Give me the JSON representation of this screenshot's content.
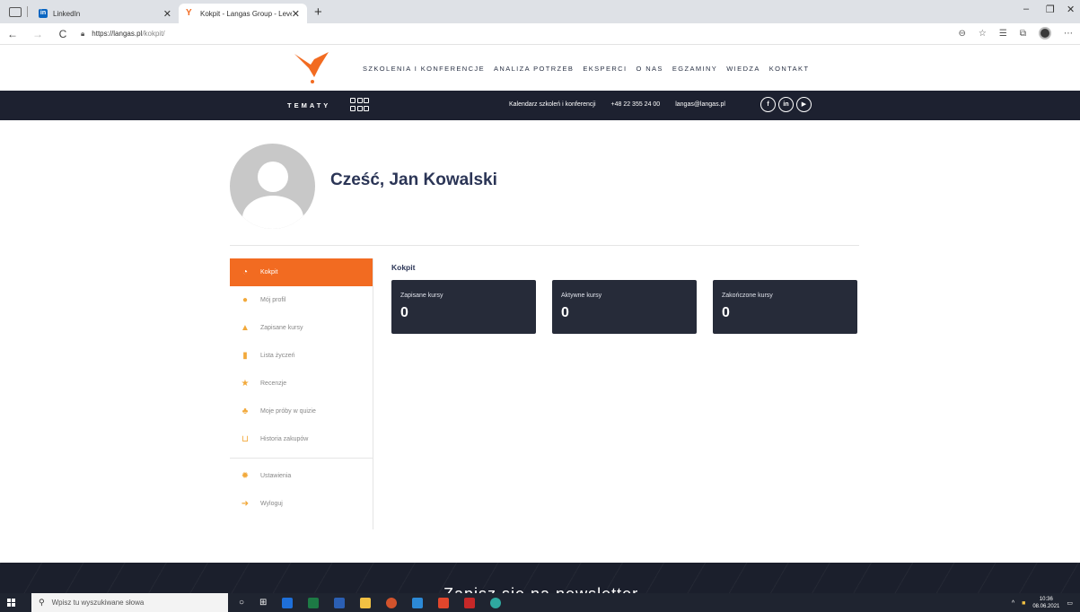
{
  "browser": {
    "tabs": [
      {
        "title": "LinkedIn",
        "active": false
      },
      {
        "title": "Kokpit - Langas Group - Level Up",
        "active": true
      }
    ],
    "url_host": "https://langas.pl",
    "url_path": "/kokpit/"
  },
  "site": {
    "nav": [
      "SZKOLENIA I KONFERENCJE",
      "ANALIZA POTRZEB",
      "EKSPERCI",
      "O NAS",
      "EGZAMINY",
      "WIEDZA",
      "KONTAKT"
    ],
    "topbar": {
      "tematy": "TEMATY",
      "calendar": "Kalendarz szkoleń i konferencji",
      "phone": "+48 22 355 24 00",
      "email": "langas@langas.pl",
      "social": [
        "f",
        "in",
        "▶"
      ]
    }
  },
  "profile": {
    "greeting": "Cześć, Jan Kowalski"
  },
  "sidebar": {
    "items": [
      {
        "label": "Kokpit",
        "icon": "dashboard-icon",
        "active": true
      },
      {
        "label": "Mój profil",
        "icon": "user-icon",
        "active": false
      },
      {
        "label": "Zapisane kursy",
        "icon": "graduation-cap-icon",
        "active": false
      },
      {
        "label": "Lista życzeń",
        "icon": "bookmark-icon",
        "active": false
      },
      {
        "label": "Recenzje",
        "icon": "star-icon",
        "active": false
      },
      {
        "label": "Moje próby w quizie",
        "icon": "quiz-icon",
        "active": false
      },
      {
        "label": "Historia zakupów",
        "icon": "cart-icon",
        "active": false
      }
    ],
    "bottom_items": [
      {
        "label": "Ustawienia",
        "icon": "gear-icon"
      },
      {
        "label": "Wyloguj",
        "icon": "logout-icon"
      }
    ]
  },
  "main": {
    "title": "Kokpit",
    "cards": [
      {
        "label": "Zapisane kursy",
        "value": "0"
      },
      {
        "label": "Aktywne kursy",
        "value": "0"
      },
      {
        "label": "Zakończone kursy",
        "value": "0"
      }
    ]
  },
  "footer": {
    "newsletter": "Zapisz się na newsletter"
  },
  "taskbar": {
    "search_placeholder": "Wpisz tu wyszukiwane słowa",
    "time": "10:36",
    "date": "08.06.2021"
  },
  "colors": {
    "accent": "#f26b21",
    "dark": "#1d2130",
    "card": "#262b39",
    "heading": "#2b3556"
  }
}
